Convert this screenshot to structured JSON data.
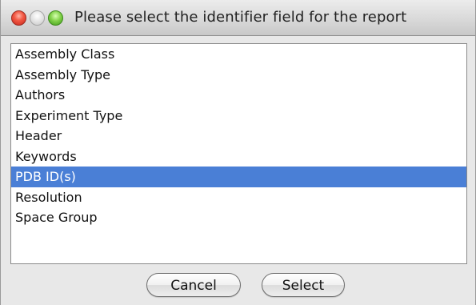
{
  "window": {
    "title": "Please select the identifier field for the report"
  },
  "list": {
    "items": [
      {
        "label": "Assembly Class",
        "selected": false
      },
      {
        "label": "Assembly Type",
        "selected": false
      },
      {
        "label": "Authors",
        "selected": false
      },
      {
        "label": "Experiment Type",
        "selected": false
      },
      {
        "label": "Header",
        "selected": false
      },
      {
        "label": "Keywords",
        "selected": false
      },
      {
        "label": "PDB ID(s)",
        "selected": true
      },
      {
        "label": "Resolution",
        "selected": false
      },
      {
        "label": "Space Group",
        "selected": false
      }
    ],
    "selected_color": "#4a7fd6"
  },
  "buttons": {
    "cancel_label": "Cancel",
    "select_label": "Select"
  }
}
